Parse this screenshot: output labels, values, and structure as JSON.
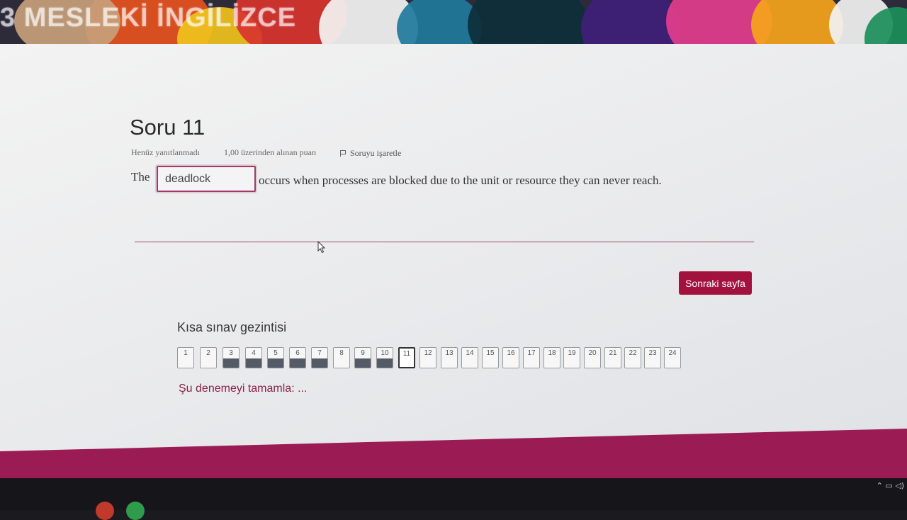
{
  "banner": {
    "title": "3 MESLEKİ İNGİLİZCE"
  },
  "question": {
    "title": "Soru 11",
    "status": "Henüz yanıtlanmadı",
    "points": "1,00 üzerinden alınan puan",
    "flag_label": "Soruyu işaretle",
    "text_before": "The",
    "answer_value": "deadlock",
    "text_after": "occurs when processes are blocked due to the unit or resource they can never reach."
  },
  "actions": {
    "next_label": "Sonraki sayfa"
  },
  "quiz_nav": {
    "title": "Kısa sınav gezintisi",
    "buttons": [
      {
        "label": "1",
        "state": "unanswered"
      },
      {
        "label": "2",
        "state": "unanswered"
      },
      {
        "label": "3",
        "state": "answered"
      },
      {
        "label": "4",
        "state": "answered"
      },
      {
        "label": "5",
        "state": "answered"
      },
      {
        "label": "6",
        "state": "answered"
      },
      {
        "label": "7",
        "state": "answered"
      },
      {
        "label": "8",
        "state": "unanswered"
      },
      {
        "label": "9",
        "state": "answered"
      },
      {
        "label": "10",
        "state": "answered"
      },
      {
        "label": "11",
        "state": "current"
      },
      {
        "label": "12",
        "state": "unanswered"
      },
      {
        "label": "13",
        "state": "unanswered"
      },
      {
        "label": "14",
        "state": "unanswered"
      },
      {
        "label": "15",
        "state": "unanswered"
      },
      {
        "label": "16",
        "state": "unanswered"
      },
      {
        "label": "17",
        "state": "unanswered"
      },
      {
        "label": "18",
        "state": "unanswered"
      },
      {
        "label": "19",
        "state": "unanswered"
      },
      {
        "label": "20",
        "state": "unanswered"
      },
      {
        "label": "21",
        "state": "unanswered"
      },
      {
        "label": "22",
        "state": "unanswered"
      },
      {
        "label": "23",
        "state": "unanswered"
      },
      {
        "label": "24",
        "state": "unanswered"
      }
    ],
    "finish_label": "Şu denemeyi tamamla: ..."
  },
  "colors": {
    "accent": "#a3113f",
    "footer": "#9b1c55",
    "answered_fill": "#555b66"
  }
}
